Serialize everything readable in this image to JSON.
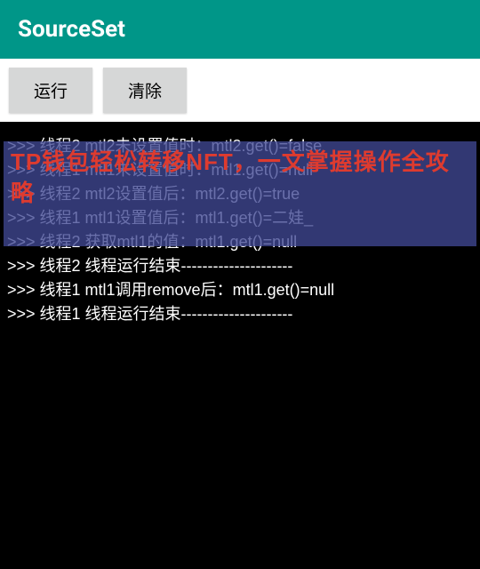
{
  "header": {
    "title": "SourceSet"
  },
  "buttons": {
    "run_label": "运行",
    "clear_label": "清除"
  },
  "console": {
    "lines": [
      ">>> 线程2 mtl2未设置值时：mtl2.get()=false",
      ">>> 线程1 mtl1未设置值时：mtl1.get()=null",
      ">>> 线程2 mtl2设置值后：mtl2.get()=true",
      ">>> 线程1 mtl1设置值后：mtl1.get()=二娃_",
      ">>> 线程2 获取mtl1的值：mtl1.get()=null",
      ">>> 线程2 线程运行结束---------------------",
      ">>> 线程1 mtl1调用remove后：mtl1.get()=null",
      ">>> 线程1 线程运行结束---------------------"
    ]
  },
  "overlay": {
    "text": "TP钱包轻松转移NFT，一文掌握操作全攻略"
  }
}
